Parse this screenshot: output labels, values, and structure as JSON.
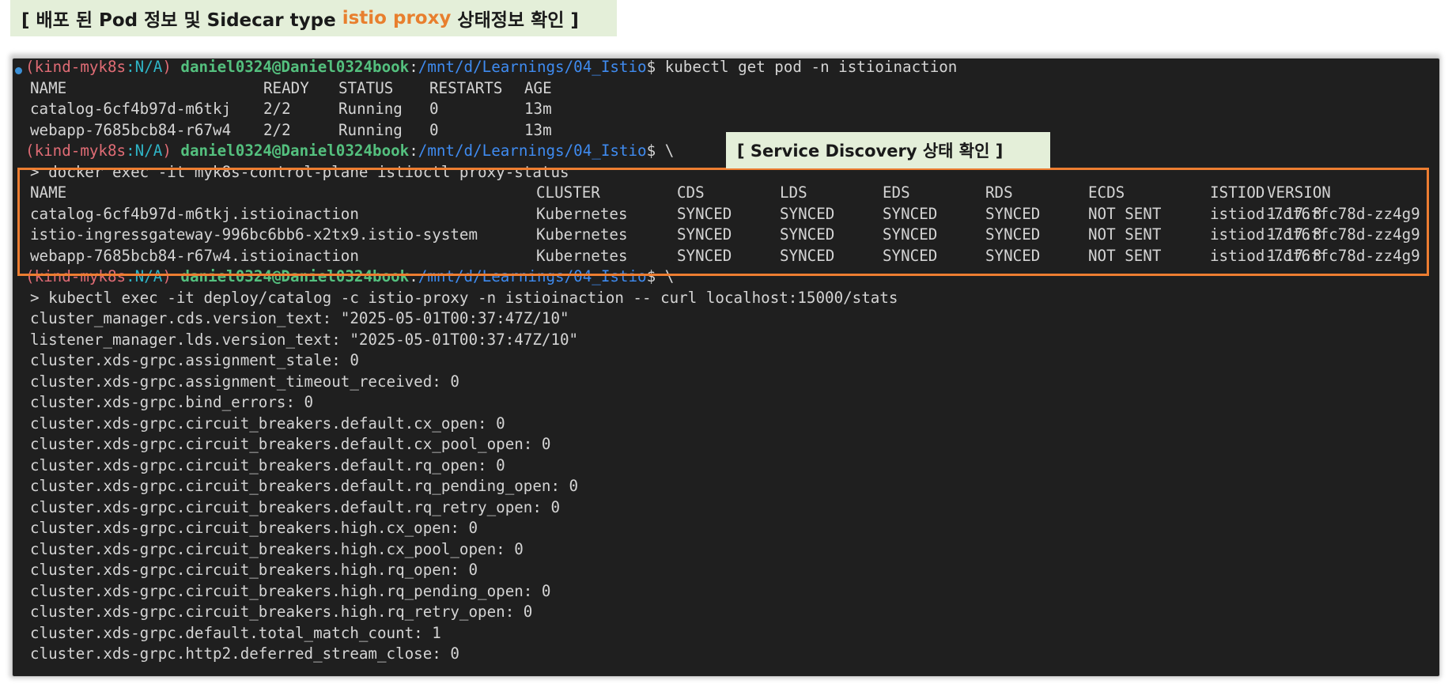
{
  "title": {
    "prefix": "[ 배포 된 Pod 정보 및 Sidecar type ",
    "accent": "istio proxy",
    "suffix": " 상태정보 확인 ]"
  },
  "sd_label": "[ Service Discovery 상태 확인 ]",
  "prompt": {
    "ctx_open": "(",
    "ctx_name": "kind-myk8s",
    "ctx_ns": ":N/A",
    "ctx_close": ") ",
    "user": "daniel0324@Daniel0324book",
    "colon": ":",
    "path": "/mnt/d/Learnings/04_Istio",
    "dollar": "$ "
  },
  "commands": {
    "get_pod": "kubectl get pod -n istioinaction",
    "continuation": "\\",
    "proxy_status": "> docker exec -it myk8s-control-plane istioctl proxy-status",
    "stats": "> kubectl exec -it deploy/catalog -c istio-proxy -n istioinaction -- curl localhost:15000/stats"
  },
  "pods_table": {
    "headers": [
      "NAME",
      "READY",
      "STATUS",
      "RESTARTS",
      "AGE"
    ],
    "rows": [
      [
        "catalog-6cf4b97d-m6tkj",
        "2/2",
        "Running",
        "0",
        "13m"
      ],
      [
        "webapp-7685bcb84-r67w4",
        "2/2",
        "Running",
        "0",
        "13m"
      ]
    ]
  },
  "proxy_table": {
    "headers": [
      "NAME",
      "CLUSTER",
      "CDS",
      "LDS",
      "EDS",
      "RDS",
      "ECDS",
      "ISTIOD",
      "VERSION"
    ],
    "rows": [
      [
        "catalog-6cf4b97d-m6tkj.istioinaction",
        "Kubernetes",
        "SYNCED",
        "SYNCED",
        "SYNCED",
        "SYNCED",
        "NOT SENT",
        "istiod-7df6ffc78d-zz4g9",
        "1.17.8"
      ],
      [
        "istio-ingressgateway-996bc6bb6-x2tx9.istio-system",
        "Kubernetes",
        "SYNCED",
        "SYNCED",
        "SYNCED",
        "SYNCED",
        "NOT SENT",
        "istiod-7df6ffc78d-zz4g9",
        "1.17.8"
      ],
      [
        "webapp-7685bcb84-r67w4.istioinaction",
        "Kubernetes",
        "SYNCED",
        "SYNCED",
        "SYNCED",
        "SYNCED",
        "NOT SENT",
        "istiod-7df6ffc78d-zz4g9",
        "1.17.8"
      ]
    ]
  },
  "stats_lines": [
    "cluster_manager.cds.version_text: \"2025-05-01T00:37:47Z/10\"",
    "listener_manager.lds.version_text: \"2025-05-01T00:37:47Z/10\"",
    "cluster.xds-grpc.assignment_stale: 0",
    "cluster.xds-grpc.assignment_timeout_received: 0",
    "cluster.xds-grpc.bind_errors: 0",
    "cluster.xds-grpc.circuit_breakers.default.cx_open: 0",
    "cluster.xds-grpc.circuit_breakers.default.cx_pool_open: 0",
    "cluster.xds-grpc.circuit_breakers.default.rq_open: 0",
    "cluster.xds-grpc.circuit_breakers.default.rq_pending_open: 0",
    "cluster.xds-grpc.circuit_breakers.default.rq_retry_open: 0",
    "cluster.xds-grpc.circuit_breakers.high.cx_open: 0",
    "cluster.xds-grpc.circuit_breakers.high.cx_pool_open: 0",
    "cluster.xds-grpc.circuit_breakers.high.rq_open: 0",
    "cluster.xds-grpc.circuit_breakers.high.rq_pending_open: 0",
    "cluster.xds-grpc.circuit_breakers.high.rq_retry_open: 0",
    "cluster.xds-grpc.default.total_match_count: 1",
    "cluster.xds-grpc.http2.deferred_stream_close: 0"
  ],
  "colors": {
    "accent_orange": "#ed7d31",
    "label_bg": "#e4efd9",
    "terminal_bg": "#1f1f1f"
  }
}
